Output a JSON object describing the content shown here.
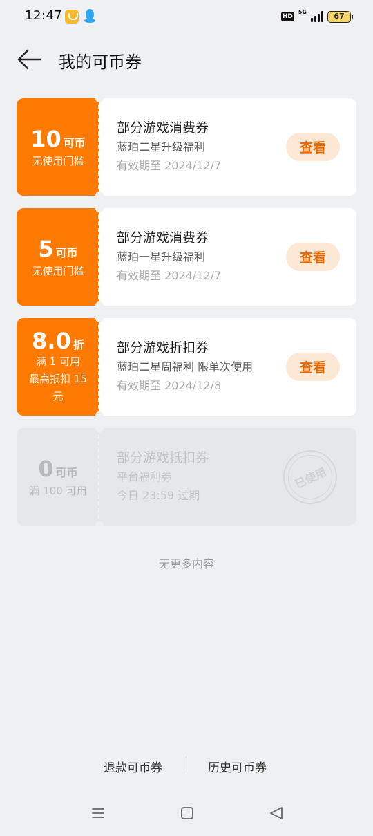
{
  "status_bar": {
    "time": "12:47",
    "icons": [
      "app-badge-icon",
      "qq-icon"
    ],
    "hd": "HD",
    "network": "5G",
    "battery": "67"
  },
  "header": {
    "back_icon": "arrow-left-icon",
    "title": "我的可币券"
  },
  "coupons": [
    {
      "value": "10",
      "unit": "可币",
      "condition": "无使用门槛",
      "title": "部分游戏消费券",
      "desc": "蓝珀二星升级福利",
      "expiry": "有效期至 2024/12/7",
      "action": "查看",
      "state": "active"
    },
    {
      "value": "5",
      "unit": "可币",
      "condition": "无使用门槛",
      "title": "部分游戏消费券",
      "desc": "蓝珀一星升级福利",
      "expiry": "有效期至 2024/12/7",
      "action": "查看",
      "state": "active"
    },
    {
      "value": "8.0",
      "unit": "折",
      "condition_lines": [
        "满 1 可用",
        "最高抵扣 15",
        "元"
      ],
      "title": "部分游戏折扣券",
      "desc": "蓝珀二星周福利 限单次使用",
      "expiry": "有效期至 2024/12/8",
      "action": "查看",
      "state": "active"
    },
    {
      "value": "0",
      "unit": "可币",
      "condition": "满 100 可用",
      "title": "部分游戏抵扣券",
      "desc": "平台福利券",
      "expiry": "今日 23:59 过期",
      "stamp": "已使用",
      "state": "used"
    }
  ],
  "no_more_text": "无更多内容",
  "footer": {
    "refund_link": "退款可币券",
    "history_link": "历史可币券"
  },
  "nav_bar": {
    "icons": [
      "menu-icon",
      "home-icon",
      "back-triangle-icon"
    ]
  },
  "colors": {
    "accent": "#ff7a00",
    "button_bg": "#fde8d6",
    "button_text": "#e06a00",
    "page_bg": "#eff0f2"
  }
}
